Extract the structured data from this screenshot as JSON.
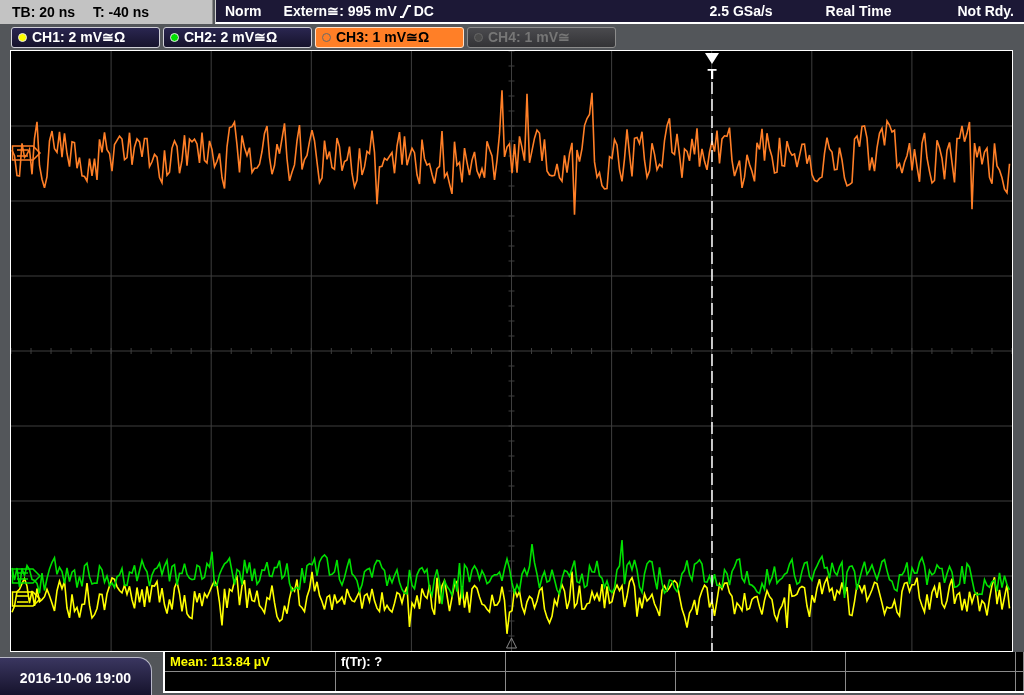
{
  "status_bar": {
    "timebase": "TB: 20 ns",
    "trigger_time": "T: -40 ns",
    "acquisition_mode": "Norm",
    "trigger_source": "Extern≅: 995 mV",
    "trigger_coupling": "DC",
    "sample_rate": "2.5 GSa/s",
    "mode": "Real Time",
    "status": "Not Rdy."
  },
  "channels": [
    {
      "label": "CH1: 2 mV≅Ω",
      "color": "#ffff00",
      "selected": false,
      "disabled": false
    },
    {
      "label": "CH2: 2 mV≅Ω",
      "color": "#00e000",
      "selected": false,
      "disabled": false
    },
    {
      "label": "CH3: 1 mV≅Ω",
      "color": "#ff7f27",
      "selected": true,
      "disabled": false
    },
    {
      "label": "CH4: 1 mV≅",
      "color": "#4a4a4a",
      "selected": false,
      "disabled": true
    }
  ],
  "display": {
    "trigger_label": "T"
  },
  "footer": {
    "date_time": "2016-10-06 19:00"
  },
  "measurements": {
    "rows": [
      [
        {
          "text": "Mean: 113.84 µV",
          "color": "#ffff00"
        },
        {
          "text": "f(Tr): ?",
          "color": "#ffffff"
        }
      ]
    ]
  }
}
